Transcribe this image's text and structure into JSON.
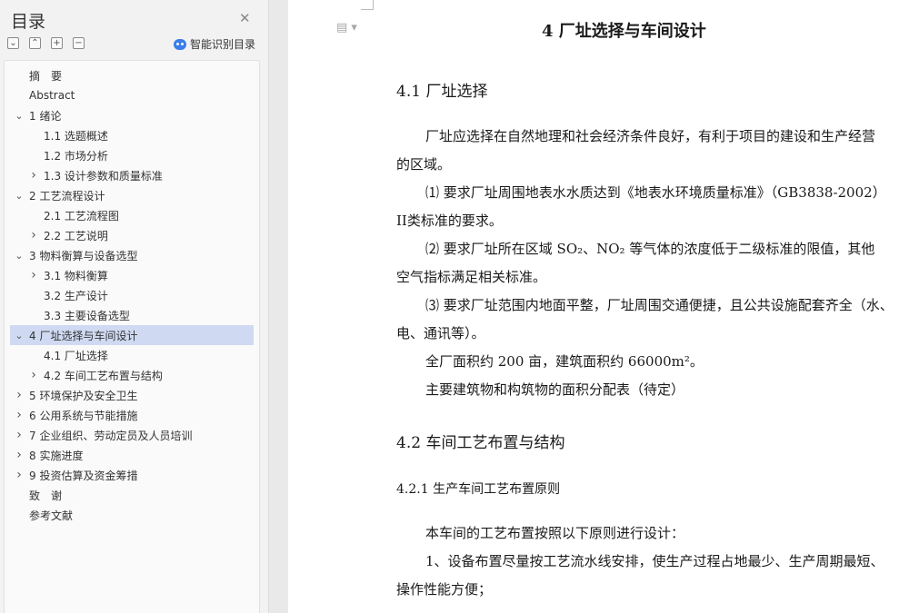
{
  "nav": {
    "title": "目录",
    "smart_toc_label": "智能识别目录",
    "toc": [
      {
        "label": "摘　要",
        "level": 0,
        "expander": "none",
        "selected": false
      },
      {
        "label": "Abstract",
        "level": 0,
        "expander": "none",
        "selected": false
      },
      {
        "label": "1 绪论",
        "level": 0,
        "expander": "expanded",
        "selected": false
      },
      {
        "label": "1.1 选题概述",
        "level": 1,
        "expander": "none",
        "selected": false
      },
      {
        "label": "1.2 市场分析",
        "level": 1,
        "expander": "none",
        "selected": false
      },
      {
        "label": "1.3 设计参数和质量标准",
        "level": 1,
        "expander": "collapsed",
        "selected": false
      },
      {
        "label": "2 工艺流程设计",
        "level": 0,
        "expander": "expanded",
        "selected": false
      },
      {
        "label": "2.1 工艺流程图",
        "level": 1,
        "expander": "none",
        "selected": false
      },
      {
        "label": "2.2 工艺说明",
        "level": 1,
        "expander": "collapsed",
        "selected": false
      },
      {
        "label": "3 物料衡算与设备选型",
        "level": 0,
        "expander": "expanded",
        "selected": false
      },
      {
        "label": "3.1 物料衡算",
        "level": 1,
        "expander": "collapsed",
        "selected": false
      },
      {
        "label": "3.2 生产设计",
        "level": 1,
        "expander": "none",
        "selected": false
      },
      {
        "label": "3.3 主要设备选型",
        "level": 1,
        "expander": "none",
        "selected": false
      },
      {
        "label": "4 厂址选择与车间设计",
        "level": 0,
        "expander": "expanded",
        "selected": true
      },
      {
        "label": "4.1 厂址选择",
        "level": 1,
        "expander": "none",
        "selected": false
      },
      {
        "label": "4.2 车间工艺布置与结构",
        "level": 1,
        "expander": "collapsed",
        "selected": false
      },
      {
        "label": "5 环境保护及安全卫生",
        "level": 0,
        "expander": "collapsed",
        "selected": false
      },
      {
        "label": "6 公用系统与节能措施",
        "level": 0,
        "expander": "collapsed",
        "selected": false
      },
      {
        "label": "7 企业组织、劳动定员及人员培训",
        "level": 0,
        "expander": "collapsed",
        "selected": false
      },
      {
        "label": "8 实施进度",
        "level": 0,
        "expander": "collapsed",
        "selected": false
      },
      {
        "label": "9 投资估算及资金筹措",
        "level": 0,
        "expander": "collapsed",
        "selected": false
      },
      {
        "label": "致　谢",
        "level": 0,
        "expander": "none",
        "selected": false
      },
      {
        "label": "参考文献",
        "level": 0,
        "expander": "none",
        "selected": false
      }
    ],
    "selected_color": "#cfdaf2"
  },
  "doc": {
    "chapter_title": "4 厂址选择与车间设计",
    "lines": [
      {
        "kind": "h2",
        "text": "4.1 厂址选择"
      },
      {
        "kind": "p",
        "text": "厂址应选择在自然地理和社会经济条件良好，有利于项目的建设和生产经营"
      },
      {
        "kind": "p",
        "text": "的区域。"
      },
      {
        "kind": "p",
        "text": "⑴ 要求厂址周围地表水水质达到《地表水环境质量标准》（GB3838-2002）"
      },
      {
        "kind": "p",
        "text": "II类标准的要求。"
      },
      {
        "kind": "p",
        "text": "⑵ 要求厂址所在区域 SO₂、NO₂ 等气体的浓度低于二级标准的限值，其他"
      },
      {
        "kind": "p",
        "text": "空气指标满足相关标准。"
      },
      {
        "kind": "p",
        "text": "⑶ 要求厂址范围内地面平整，厂址周围交通便捷，且公共设施配套齐全（水、"
      },
      {
        "kind": "p",
        "text": "电、通讯等）。"
      },
      {
        "kind": "p",
        "text": "全厂面积约 200 亩，建筑面积约 66000m²。"
      },
      {
        "kind": "p",
        "text": "主要建筑物和构筑物的面积分配表（待定）"
      },
      {
        "kind": "h2",
        "text": "4.2 车间工艺布置与结构"
      },
      {
        "kind": "h3",
        "text": "4.2.1 生产车间工艺布置原则"
      },
      {
        "kind": "p",
        "text": "本车间的工艺布置按照以下原则进行设计："
      },
      {
        "kind": "p",
        "text": "1、设备布置尽量按工艺流水线安排，使生产过程占地最少、生产周期最短、"
      },
      {
        "kind": "p",
        "text": "操作性能方便；"
      }
    ]
  }
}
